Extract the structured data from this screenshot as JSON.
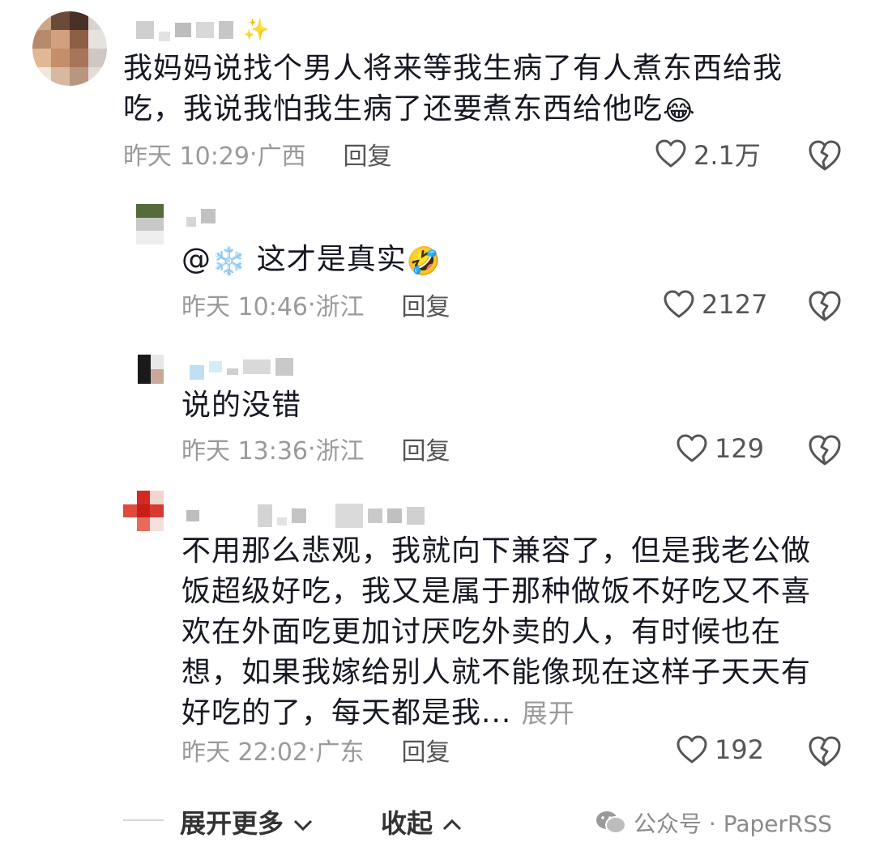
{
  "comments": [
    {
      "text": "我妈妈说找个男人将来等我生病了有人煮东西给我吃，我说我怕我生病了还要煮东西给他吃",
      "emoji": "😂",
      "time": "昨天 10:29",
      "location": "广西",
      "reply_label": "回复",
      "likes": "2.1万"
    },
    {
      "mention": "@",
      "mention_emoji": "❄️",
      "text": "这才是真实",
      "emoji": "🤣",
      "time": "昨天 10:46",
      "location": "浙江",
      "reply_label": "回复",
      "likes": "2127"
    },
    {
      "text": "说的没错",
      "time": "昨天 13:36",
      "location": "浙江",
      "reply_label": "回复",
      "likes": "129"
    },
    {
      "text": "不用那么悲观，我就向下兼容了，但是我老公做饭超级好吃，我又是属于那种做饭不好吃又不喜欢在外面吃更加讨厌吃外卖的人，有时候也在想，如果我嫁给别人就不能像现在这样子天天有好吃的了，每天都是我...",
      "expand_label": "展开",
      "time": "昨天 22:02",
      "location": "广东",
      "reply_label": "回复",
      "likes": "192"
    }
  ],
  "footer": {
    "show_more": "展开更多",
    "collapse": "收起"
  },
  "watermark": "公众号 · PaperRSS",
  "colors": {
    "text": "#161823",
    "meta": "#9a9a9a",
    "icon": "#555555"
  },
  "icons": [
    "heart-outline-icon",
    "broken-heart-icon",
    "chevron-down-icon",
    "chevron-up-icon",
    "wechat-icon"
  ]
}
